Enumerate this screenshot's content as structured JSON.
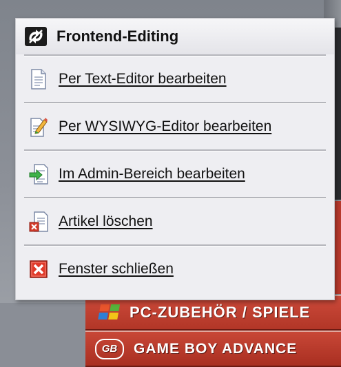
{
  "popup": {
    "title": "Frontend-Editing",
    "header_icon": "frontend-editing-icon",
    "items": [
      {
        "label": "Per Text-Editor bearbeiten",
        "icon": "text-document-icon"
      },
      {
        "label": "Per WYSIWYG-Editor bearbeiten",
        "icon": "pencil-document-icon"
      },
      {
        "label": "Im Admin-Bereich bearbeiten",
        "icon": "arrow-document-icon"
      },
      {
        "label": "Artikel löschen",
        "icon": "delete-document-icon"
      },
      {
        "label": "Fenster schließen",
        "icon": "close-window-icon"
      }
    ]
  },
  "nav": {
    "items": [
      {
        "label": "PC-ZUBEHÖR / SPIELE",
        "icon": "windows-flag-icon"
      },
      {
        "label": "GAME BOY ADVANCE",
        "icon": "gameboy-logo-icon",
        "logo_text": "GB"
      }
    ]
  },
  "colors": {
    "nav_red": "#b23627",
    "popup_bg": "#eeeef2",
    "header_icon_bg": "#1c1c1c"
  }
}
